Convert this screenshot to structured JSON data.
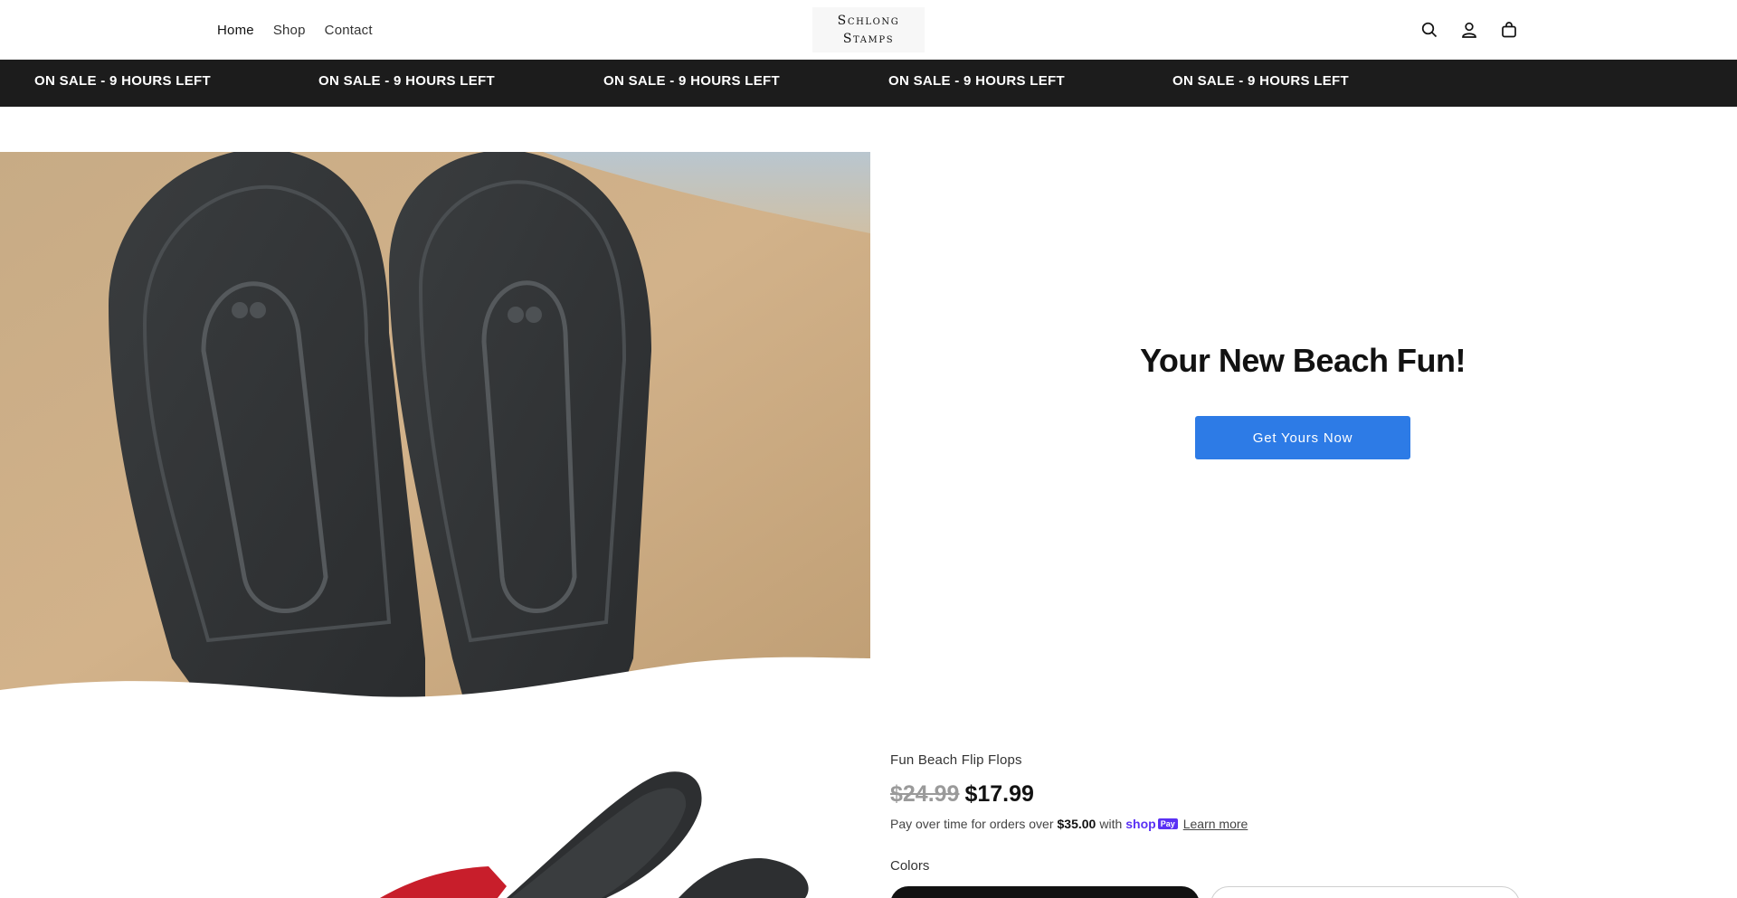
{
  "header": {
    "nav": [
      "Home",
      "Shop",
      "Contact"
    ],
    "logo_line1": "Schlong",
    "logo_line2": "Stamps",
    "icons": [
      "search-icon",
      "account-icon",
      "cart-icon"
    ]
  },
  "announcement": {
    "items": [
      "ON SALE - 9 HOURS LEFT",
      "ON SALE - 9 HOURS LEFT",
      "ON SALE - 9 HOURS LEFT",
      "ON SALE - 9 HOURS LEFT",
      "ON SALE - 9 HOURS LEFT"
    ]
  },
  "hero": {
    "title": "Your New Beach Fun!",
    "button": "Get Yours Now"
  },
  "product": {
    "title": "Fun Beach Flip Flops",
    "price_old": "$24.99",
    "price_new": "$17.99",
    "installments_prefix": "Pay over time for orders over",
    "installments_amount": "$35.00",
    "installments_with": "with",
    "shop_label": "shop",
    "pay_label": "Pay",
    "learn_more": "Learn more",
    "colors_label": "Colors"
  },
  "colors": {
    "accent_button": "#2d7be6",
    "announcement_bg": "#1c1c1c",
    "shop_pay": "#5a31f4"
  }
}
